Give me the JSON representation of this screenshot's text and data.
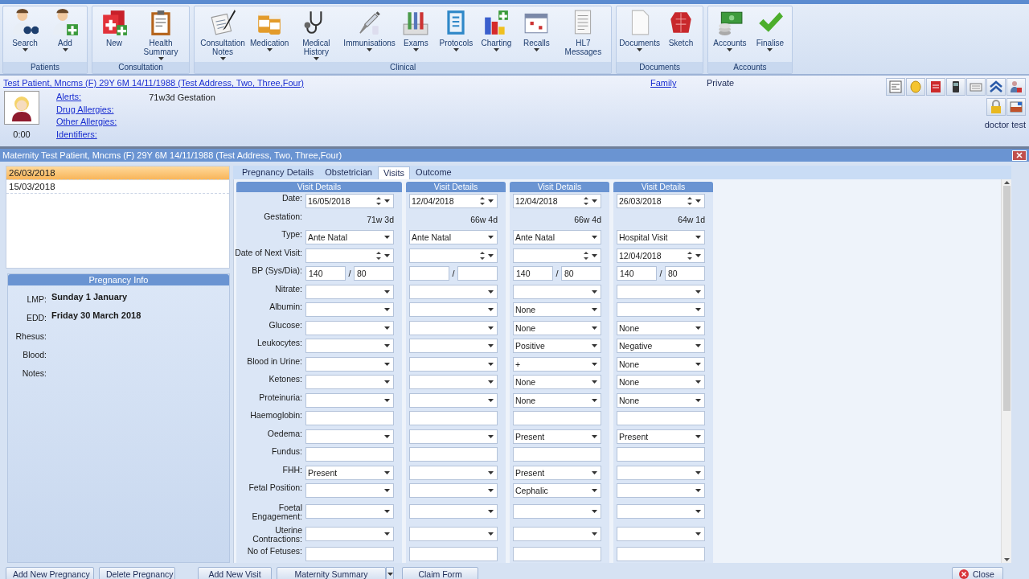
{
  "ribbon": {
    "groups": [
      {
        "label": "Patients",
        "buttons": [
          {
            "label": "Search",
            "dropdown": true
          },
          {
            "label": "Add",
            "dropdown": true
          }
        ]
      },
      {
        "label": "Consultation",
        "buttons": [
          {
            "label": "New",
            "dropdown": false
          },
          {
            "label": "Health Summary",
            "dropdown": true
          }
        ]
      },
      {
        "label": "Clinical",
        "buttons": [
          {
            "label": "Consultation Notes",
            "dropdown": true
          },
          {
            "label": "Medication",
            "dropdown": true
          },
          {
            "label": "Medical History",
            "dropdown": true
          },
          {
            "label": "Immunisations",
            "dropdown": true
          },
          {
            "label": "Exams",
            "dropdown": true
          },
          {
            "label": "Protocols",
            "dropdown": true
          },
          {
            "label": "Charting",
            "dropdown": true
          },
          {
            "label": "Recalls",
            "dropdown": true
          },
          {
            "label": "HL7 Messages",
            "dropdown": false
          }
        ]
      },
      {
        "label": "Documents",
        "buttons": [
          {
            "label": "Documents",
            "dropdown": true
          },
          {
            "label": "Sketch",
            "dropdown": false
          }
        ]
      },
      {
        "label": "Accounts",
        "buttons": [
          {
            "label": "Accounts",
            "dropdown": true
          },
          {
            "label": "Finalise",
            "dropdown": true
          }
        ]
      }
    ]
  },
  "patient_banner": {
    "patient": "Test Patient, Mncms (F) 29Y 6M   14/11/1988  (Test Address, Two, Three,Four)",
    "links": [
      "Alerts:",
      "Drug Allergies:",
      "Other Allergies:",
      "Identifiers:"
    ],
    "alert_text": "71w3d Gestation",
    "timer": "0:00",
    "family": "Family",
    "billing": "Private",
    "user": "doctor test"
  },
  "maternity": {
    "title": "Maternity Test Patient, Mncms (F) 29Y 6M   14/11/1988  (Test Address, Two, Three,Four)",
    "visits": [
      {
        "date": "26/03/2018",
        "selected": true
      },
      {
        "date": "15/03/2018",
        "selected": false
      }
    ],
    "pregnancy_info": {
      "title": "Pregnancy Info",
      "fields": [
        {
          "label": "LMP:",
          "value": "Sunday 1 January"
        },
        {
          "label": "EDD:",
          "value": "Friday 30 March 2018"
        },
        {
          "label": "Rhesus:"
        },
        {
          "label": "Blood:"
        },
        {
          "label": "Notes:"
        }
      ]
    },
    "tabs": [
      {
        "label": "Pregnancy Details",
        "selected": false
      },
      {
        "label": "Obstetrician",
        "selected": false
      },
      {
        "label": "Visits",
        "selected": true
      },
      {
        "label": "Outcome",
        "selected": false
      }
    ],
    "form": {
      "rows": [
        {
          "label": "Date:",
          "kind": "date"
        },
        {
          "label": "Gestation:",
          "kind": "readonly"
        },
        {
          "label": "Type:",
          "kind": "combo"
        },
        {
          "label": "Date of Next Visit:",
          "kind": "date"
        },
        {
          "label": "BP (Sys/Dia):",
          "kind": "bp",
          "separator": "/"
        },
        {
          "label": "Nitrate:",
          "kind": "combo"
        },
        {
          "label": "Albumin:",
          "kind": "combo"
        },
        {
          "label": "Glucose:",
          "kind": "combo"
        },
        {
          "label": "Leukocytes:",
          "kind": "combo"
        },
        {
          "label": "Blood in Urine:",
          "kind": "combo"
        },
        {
          "label": "Ketones:",
          "kind": "combo"
        },
        {
          "label": "Proteinuria:",
          "kind": "combo"
        },
        {
          "label": "Haemoglobin:",
          "kind": "text"
        },
        {
          "label": "Oedema:",
          "kind": "combo"
        },
        {
          "label": "Fundus:",
          "kind": "text"
        },
        {
          "label": "FHH:",
          "kind": "combo"
        },
        {
          "label": "Fetal Position:",
          "kind": "combo"
        },
        {
          "label": "Foetal Engagement:",
          "kind": "combo"
        },
        {
          "label": "Uterine Contractions:",
          "kind": "combo"
        },
        {
          "label": "No of Fetuses:",
          "kind": "text"
        }
      ],
      "columns": [
        {
          "header": "Visit Details",
          "cells": [
            {
              "value": "16/05/2018"
            },
            {
              "value": "71w 3d"
            },
            {
              "value": "Ante Natal"
            },
            {},
            {
              "sys": "140",
              "dia": "80"
            },
            {},
            {},
            {},
            {},
            {},
            {},
            {},
            {},
            {},
            {},
            {
              "value": "Present"
            },
            {},
            {},
            {},
            {}
          ]
        },
        {
          "header": "Visit Details",
          "cells": [
            {
              "value": "12/04/2018"
            },
            {
              "value": "66w 4d"
            },
            {
              "value": "Ante Natal"
            },
            {},
            {},
            {},
            {},
            {},
            {},
            {},
            {},
            {},
            {},
            {},
            {},
            {},
            {},
            {},
            {},
            {}
          ]
        },
        {
          "header": "Visit Details",
          "cells": [
            {
              "value": "12/04/2018"
            },
            {
              "value": "66w 4d"
            },
            {
              "value": "Ante Natal"
            },
            {},
            {
              "sys": "140",
              "dia": "80"
            },
            {},
            {
              "value": "None"
            },
            {
              "value": "None"
            },
            {
              "value": "Positive"
            },
            {
              "value": "+"
            },
            {
              "value": "None"
            },
            {
              "value": "None"
            },
            {},
            {
              "value": "Present"
            },
            {},
            {
              "value": "Present"
            },
            {
              "value": "Cephalic"
            },
            {},
            {},
            {}
          ]
        },
        {
          "header": "Visit Details",
          "cells": [
            {
              "value": "26/03/2018"
            },
            {
              "value": "64w 1d"
            },
            {
              "value": "Hospital Visit"
            },
            {
              "value": "12/04/2018"
            },
            {
              "sys": "140",
              "dia": "80"
            },
            {},
            {},
            {
              "value": "None"
            },
            {
              "value": "Negative"
            },
            {
              "value": "None"
            },
            {
              "value": "None"
            },
            {
              "value": "None"
            },
            {},
            {
              "value": "Present"
            },
            {},
            {},
            {},
            {},
            {},
            {}
          ]
        }
      ]
    },
    "footer": {
      "left": [
        "Add New Pregnancy",
        "Delete Pregnancy"
      ],
      "middle": [
        {
          "label": "Add New Visit",
          "split": false
        },
        {
          "label": "Maternity Summary",
          "split": true
        },
        {
          "label": "Claim Form",
          "split": false
        }
      ],
      "close": "Close"
    }
  }
}
